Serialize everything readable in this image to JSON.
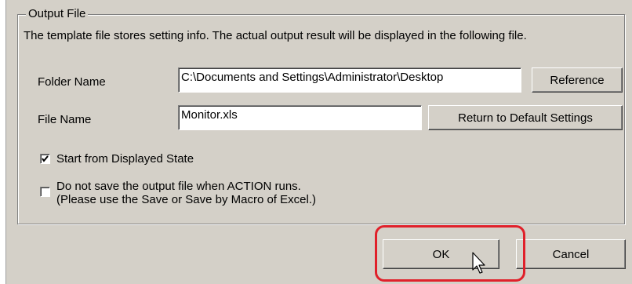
{
  "group": {
    "title": "Output File",
    "description": "The template file stores setting info. The actual output result will be displayed in the following file."
  },
  "folder": {
    "label": "Folder Name",
    "value": "C:\\Documents and Settings\\Administrator\\Desktop",
    "button_label": "Reference"
  },
  "file": {
    "label": "File Name",
    "value": "Monitor.xls",
    "button_label": "Return to Default Settings"
  },
  "options": [
    {
      "checked": true,
      "lines": [
        "Start from Displayed State"
      ]
    },
    {
      "checked": false,
      "lines": [
        "Do not save the output file when ACTION runs.",
        "(Please use the Save or Save by Macro of Excel.)"
      ]
    }
  ],
  "buttons": {
    "ok": "OK",
    "cancel": "Cancel"
  },
  "colors": {
    "highlight": "#e0202a",
    "dialog_bg": "#d4d0c8"
  }
}
